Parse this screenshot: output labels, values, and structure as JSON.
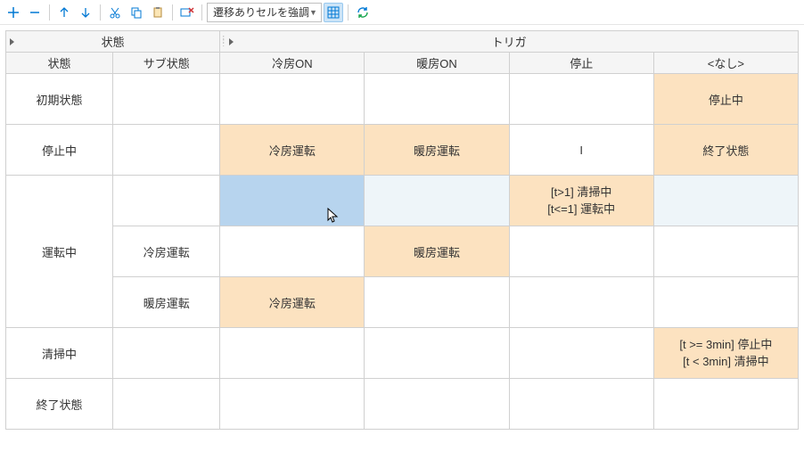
{
  "toolbar": {
    "dropdown_label": "遷移ありセルを強調"
  },
  "headers": {
    "state_group": "状態",
    "trigger_group": "トリガ",
    "state": "状態",
    "substate": "サブ状態",
    "cooling_on": "冷房ON",
    "heating_on": "暖房ON",
    "stop": "停止",
    "none": "<なし>"
  },
  "rows": {
    "initial": {
      "label": "初期状態",
      "none": "停止中"
    },
    "stopped": {
      "label": "停止中",
      "cooling_on": "冷房運転",
      "heating_on": "暖房運転",
      "stop": "I",
      "none": "終了状態"
    },
    "running": {
      "label": "運転中",
      "base": {
        "stop_line1": "[t>1] 清掃中",
        "stop_line2": "[t<=1] 運転中"
      },
      "cooling": {
        "sub_label": "冷房運転",
        "heating_on": "暖房運転"
      },
      "heating": {
        "sub_label": "暖房運転",
        "cooling_on": "冷房運転"
      }
    },
    "cleaning": {
      "label": "清掃中",
      "none_line1": "[t >= 3min] 停止中",
      "none_line2": "[t < 3min] 清掃中"
    },
    "final": {
      "label": "終了状態"
    }
  }
}
